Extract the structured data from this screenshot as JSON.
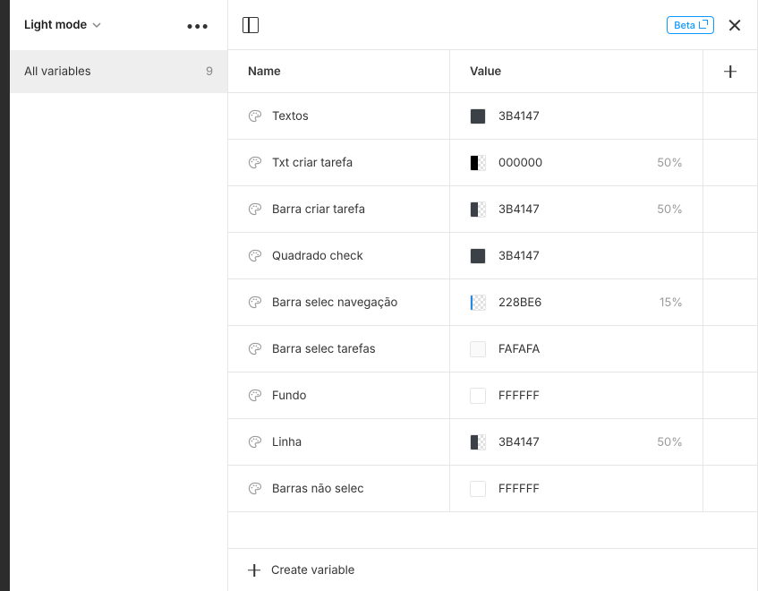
{
  "sidebar": {
    "mode_label": "Light mode",
    "group_label": "All variables",
    "group_count": "9"
  },
  "header": {
    "beta_label": "Beta"
  },
  "columns": {
    "name_label": "Name",
    "value_label": "Value"
  },
  "footer": {
    "create_label": "Create variable"
  },
  "variables": [
    {
      "name": "Textos",
      "hex": "3B4147",
      "color": "#3B4147",
      "opacity": null
    },
    {
      "name": "Txt criar tarefa",
      "hex": "000000",
      "color": "#000000",
      "opacity": "50%"
    },
    {
      "name": "Barra criar tarefa",
      "hex": "3B4147",
      "color": "#3B4147",
      "opacity": "50%"
    },
    {
      "name": "Quadrado check",
      "hex": "3B4147",
      "color": "#3B4147",
      "opacity": null
    },
    {
      "name": "Barra selec navegação",
      "hex": "228BE6",
      "color": "#228BE6",
      "opacity": "15%"
    },
    {
      "name": "Barra selec tarefas",
      "hex": "FAFAFA",
      "color": "#FAFAFA",
      "opacity": null
    },
    {
      "name": "Fundo",
      "hex": "FFFFFF",
      "color": "#FFFFFF",
      "opacity": null
    },
    {
      "name": "Linha",
      "hex": "3B4147",
      "color": "#3B4147",
      "opacity": "50%"
    },
    {
      "name": "Barras não selec",
      "hex": "FFFFFF",
      "color": "#FFFFFF",
      "opacity": null
    }
  ]
}
